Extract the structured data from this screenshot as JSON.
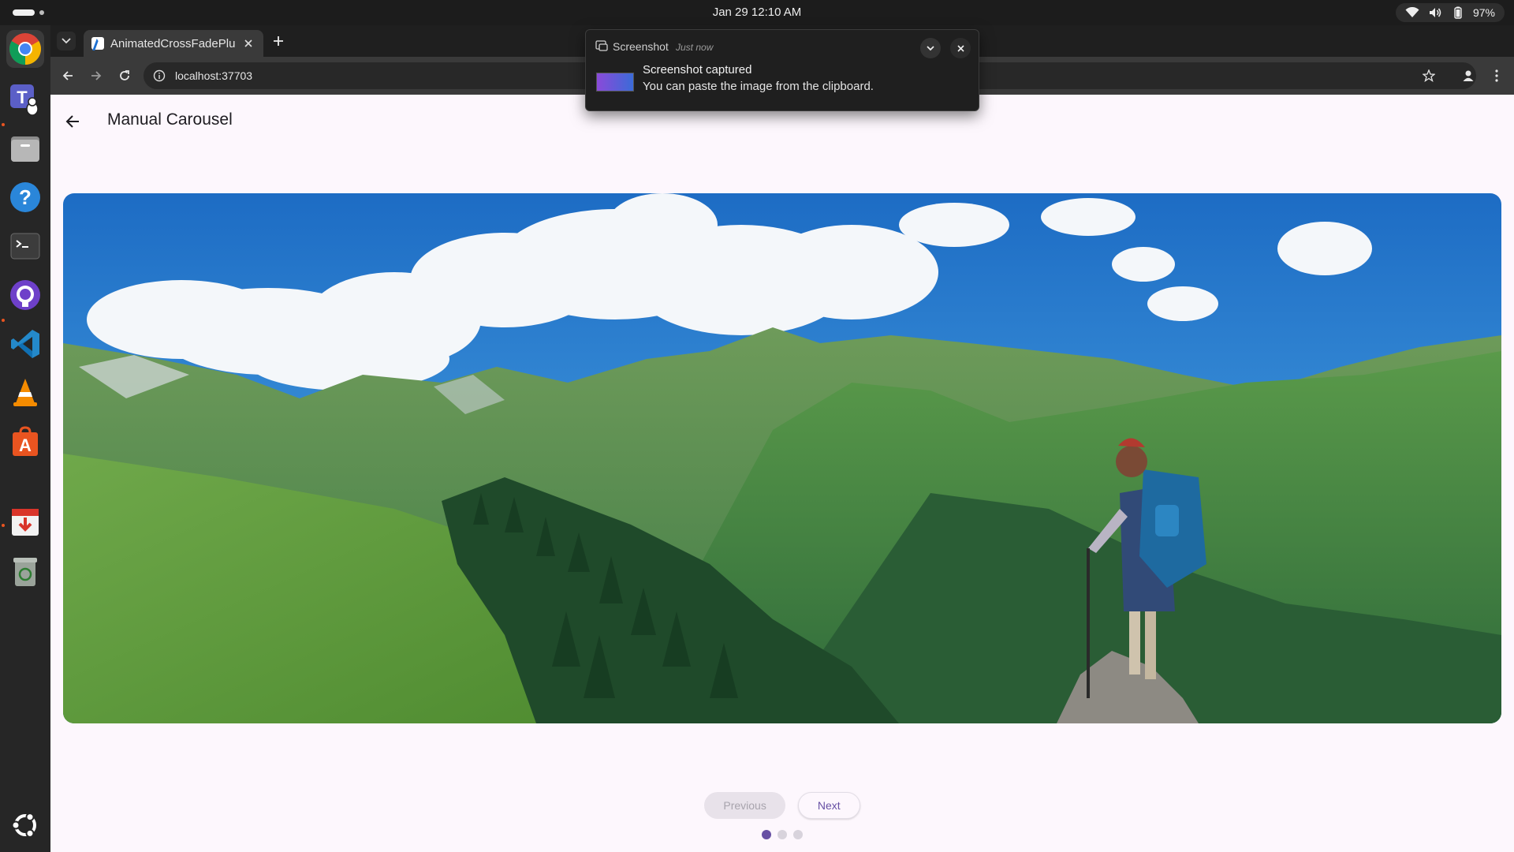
{
  "system_bar": {
    "clock": "Jan 29  12:10 AM",
    "battery": "97%"
  },
  "dock": {
    "items": [
      {
        "name": "chrome-icon"
      },
      {
        "name": "teams-icon"
      },
      {
        "name": "files-icon"
      },
      {
        "name": "help-icon"
      },
      {
        "name": "terminal-icon"
      },
      {
        "name": "github-icon"
      },
      {
        "name": "vscode-icon"
      },
      {
        "name": "vlc-icon"
      },
      {
        "name": "app-center-icon"
      },
      {
        "name": "installer-icon"
      },
      {
        "name": "trash-icon"
      },
      {
        "name": "ubuntu-icon"
      }
    ]
  },
  "browser": {
    "tab_title": "AnimatedCrossFadePlus",
    "url": "localhost:37703"
  },
  "page": {
    "title": "Manual Carousel",
    "previous_label": "Previous",
    "next_label": "Next",
    "slide_count": 3,
    "active_slide": 1
  },
  "notification": {
    "app": "Screenshot",
    "time": "Just now",
    "title": "Screenshot captured",
    "body": "You can paste the image from the clipboard."
  },
  "colors": {
    "accent": "#6750a4",
    "page_bg": "#fdf7fd"
  }
}
